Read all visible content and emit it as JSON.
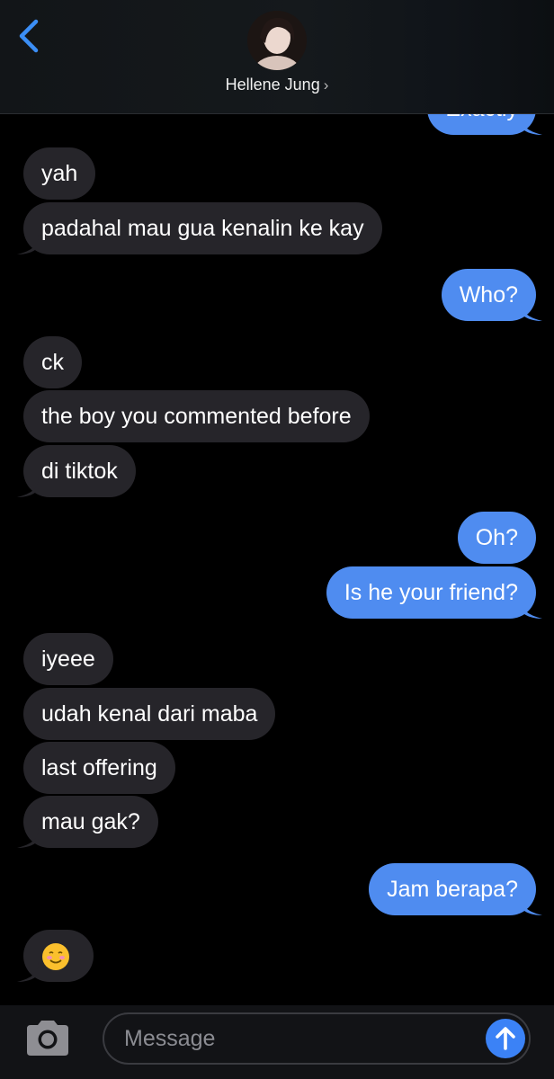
{
  "header": {
    "contact_name": "Hellene Jung",
    "chevron": "›"
  },
  "messages": [
    {
      "text": "Exactly",
      "from": "me"
    },
    {
      "text": "yah",
      "from": "them"
    },
    {
      "text": "padahal mau gua kenalin ke kay",
      "from": "them"
    },
    {
      "text": "Who?",
      "from": "me"
    },
    {
      "text": "ck",
      "from": "them"
    },
    {
      "text": "the boy you commented before",
      "from": "them"
    },
    {
      "text": "di tiktok",
      "from": "them"
    },
    {
      "text": "Oh?",
      "from": "me"
    },
    {
      "text": "Is he your friend?",
      "from": "me"
    },
    {
      "text": "iyeee",
      "from": "them"
    },
    {
      "text": "udah kenal dari maba",
      "from": "them"
    },
    {
      "text": "last offering",
      "from": "them"
    },
    {
      "text": "mau gak?",
      "from": "them"
    },
    {
      "text": "Jam berapa?",
      "from": "me"
    },
    {
      "text": "☺️",
      "from": "them"
    }
  ],
  "composer": {
    "placeholder": "Message"
  },
  "icons": {
    "back": "chevron-left-icon",
    "camera": "camera-icon",
    "send": "arrow-up-icon"
  },
  "colors": {
    "incoming": "#26252a",
    "outgoing": "#4f8cf0",
    "accent": "#3b82f6"
  }
}
